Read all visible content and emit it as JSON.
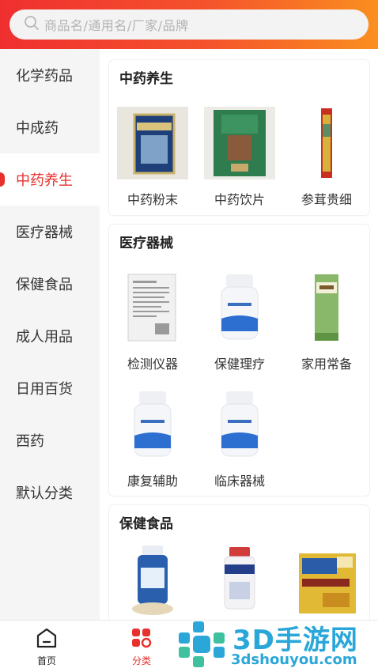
{
  "search": {
    "placeholder": "商品名/通用名/厂家/品牌"
  },
  "sidebar": {
    "items": [
      {
        "label": "化学药品",
        "active": false
      },
      {
        "label": "中成药",
        "active": false
      },
      {
        "label": "中药养生",
        "active": true
      },
      {
        "label": "医疗器械",
        "active": false
      },
      {
        "label": "保健食品",
        "active": false
      },
      {
        "label": "成人用品",
        "active": false
      },
      {
        "label": "日用百货",
        "active": false
      },
      {
        "label": "西药",
        "active": false
      },
      {
        "label": "默认分类",
        "active": false
      }
    ]
  },
  "sections": [
    {
      "title": "中药养生",
      "items": [
        {
          "label": "中药粉末",
          "icon": "powder-box-image"
        },
        {
          "label": "中药饮片",
          "icon": "herb-bag-image"
        },
        {
          "label": "参茸贵细",
          "icon": "ginseng-tube-image"
        }
      ]
    },
    {
      "title": "医疗器械",
      "items": [
        {
          "label": "检测仪器",
          "icon": "instruction-sheet-image"
        },
        {
          "label": "保健理疗",
          "icon": "medicine-bottle-image"
        },
        {
          "label": "家用常备",
          "icon": "green-box-image"
        },
        {
          "label": "康复辅助",
          "icon": "medicine-bottle-image"
        },
        {
          "label": "临床器械",
          "icon": "medicine-bottle-image"
        }
      ]
    },
    {
      "title": "保健食品",
      "items": [
        {
          "label": "",
          "icon": "supplement-bottle-image"
        },
        {
          "label": "",
          "icon": "supplement-bottle-image"
        },
        {
          "label": "",
          "icon": "gold-box-image"
        }
      ]
    }
  ],
  "tabbar": {
    "home": {
      "label": "首页",
      "icon": "home-icon"
    },
    "category": {
      "label": "分类",
      "icon": "category-grid-icon",
      "active": true
    }
  },
  "watermark": {
    "line1": "3D手游网",
    "line2": "3dshouyou.com"
  },
  "colors": {
    "accent": "#e8302c",
    "gradient_start": "#ef2f2f",
    "gradient_end": "#fa8f1f",
    "watermark": "#2aa7d8"
  }
}
